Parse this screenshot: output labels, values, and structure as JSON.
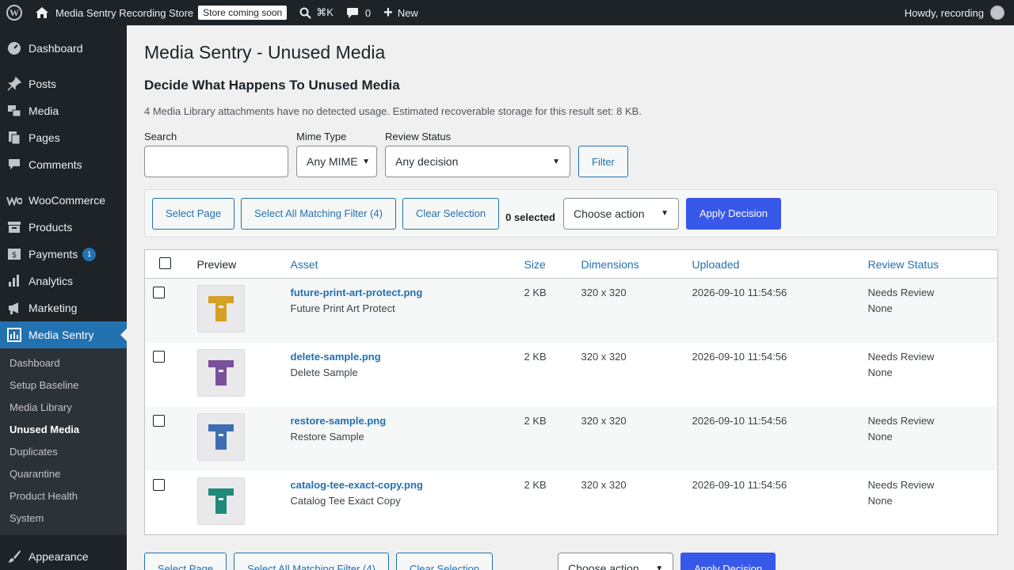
{
  "adminbar": {
    "site_name": "Media Sentry Recording Store",
    "badge": "Store coming soon",
    "search_shortcut": "⌘K",
    "comments_count": "0",
    "new_label": "New",
    "howdy": "Howdy, recording"
  },
  "sidebar": {
    "items": [
      {
        "label": "Dashboard",
        "icon": "dashboard-icon"
      },
      {
        "label": "Posts",
        "icon": "pin-icon"
      },
      {
        "label": "Media",
        "icon": "media-icon"
      },
      {
        "label": "Pages",
        "icon": "pages-icon"
      },
      {
        "label": "Comments",
        "icon": "comment-icon"
      },
      {
        "label": "WooCommerce",
        "icon": "woo-icon"
      },
      {
        "label": "Products",
        "icon": "archive-icon"
      },
      {
        "label": "Payments",
        "icon": "payments-icon",
        "badge": "1"
      },
      {
        "label": "Analytics",
        "icon": "chart-icon"
      },
      {
        "label": "Marketing",
        "icon": "megaphone-icon"
      },
      {
        "label": "Media Sentry",
        "icon": "sentry-icon"
      }
    ],
    "submenu": [
      "Dashboard",
      "Setup Baseline",
      "Media Library",
      "Unused Media",
      "Duplicates",
      "Quarantine",
      "Product Health",
      "System"
    ],
    "appearance": "Appearance"
  },
  "main": {
    "title": "Media Sentry - Unused Media",
    "subtitle": "Decide What Happens To Unused Media",
    "summary": "4 Media Library attachments have no detected usage. Estimated recoverable storage for this result set: 8 KB.",
    "filters": {
      "search_label": "Search",
      "search_value": "",
      "mime_label": "Mime Type",
      "mime_value": "Any MIME",
      "review_label": "Review Status",
      "review_value": "Any decision",
      "filter_button": "Filter"
    },
    "bulk": {
      "select_page": "Select Page",
      "select_all": "Select All Matching Filter (4)",
      "clear": "Clear Selection",
      "selected": "0 selected",
      "action": "Choose action",
      "apply": "Apply Decision"
    },
    "table": {
      "headers": [
        "Preview",
        "Asset",
        "Size",
        "Dimensions",
        "Uploaded",
        "Review Status"
      ],
      "rows": [
        {
          "file": "future-print-art-protect.png",
          "title": "Future Print Art Protect",
          "size": "2 KB",
          "dims": "320 x 320",
          "uploaded": "2026-09-10 11:54:56",
          "status": "Needs Review",
          "decision": "None",
          "color": "#d6a024"
        },
        {
          "file": "delete-sample.png",
          "title": "Delete Sample",
          "size": "2 KB",
          "dims": "320 x 320",
          "uploaded": "2026-09-10 11:54:56",
          "status": "Needs Review",
          "decision": "None",
          "color": "#7a4f9c"
        },
        {
          "file": "restore-sample.png",
          "title": "Restore Sample",
          "size": "2 KB",
          "dims": "320 x 320",
          "uploaded": "2026-09-10 11:54:56",
          "status": "Needs Review",
          "decision": "None",
          "color": "#3e6db5"
        },
        {
          "file": "catalog-tee-exact-copy.png",
          "title": "Catalog Tee Exact Copy",
          "size": "2 KB",
          "dims": "320 x 320",
          "uploaded": "2026-09-10 11:54:56",
          "status": "Needs Review",
          "decision": "None",
          "color": "#1f8a7a"
        }
      ]
    }
  }
}
